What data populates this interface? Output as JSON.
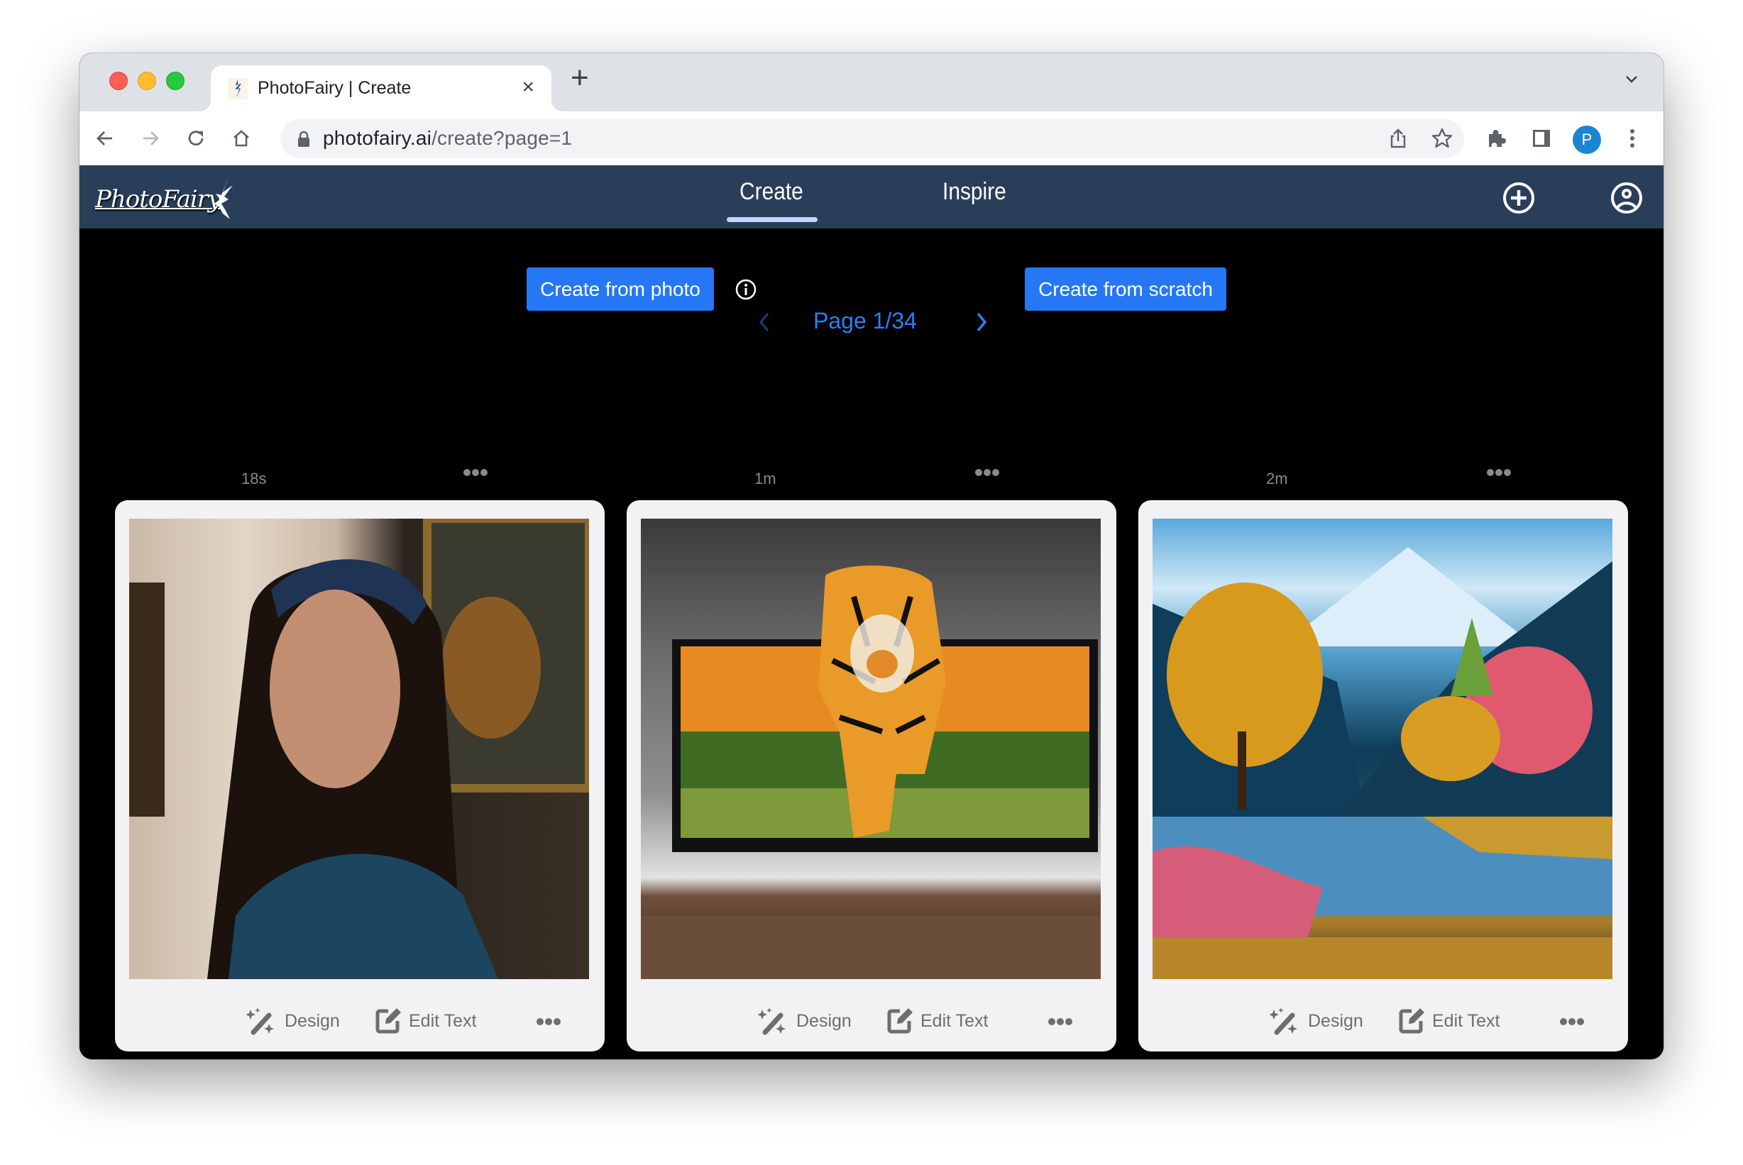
{
  "browser": {
    "tab_title": "PhotoFairy | Create",
    "tab_close": "×",
    "new_tab": "+",
    "url_host": "photofairy.ai",
    "url_path": "/create?page=1",
    "profile_initial": "P",
    "colors": {
      "profile": "#1a85d2",
      "tabstrip": "#dee1e6"
    }
  },
  "app": {
    "logo_text": "PhotoFairy",
    "nav": [
      {
        "label": "Create",
        "active": true
      },
      {
        "label": "Inspire",
        "active": false
      }
    ],
    "header_icons": [
      "add-circle-icon",
      "user-circle-icon"
    ],
    "colors": {
      "header_bg": "#293e59",
      "active_underline": "#bfd8fb",
      "primary": "#2577f5",
      "page_bg": "#000000"
    }
  },
  "main": {
    "create_from_photo": "Create from photo",
    "create_from_scratch": "Create from scratch",
    "pagination": {
      "label": "Page 1/34",
      "current": 1,
      "total": 34
    },
    "cards": [
      {
        "time": "18s",
        "image": "Woman in blue headscarf in front of Mona Lisa painting",
        "design_label": "Design",
        "edit_text_label": "Edit Text"
      },
      {
        "time": "1m",
        "image": "Tiger stepping out of a TV screen",
        "design_label": "Design",
        "edit_text_label": "Edit Text"
      },
      {
        "time": "2m",
        "image": "Painted mountain lake landscape with colorful trees",
        "design_label": "Design",
        "edit_text_label": "Edit Text"
      }
    ]
  }
}
